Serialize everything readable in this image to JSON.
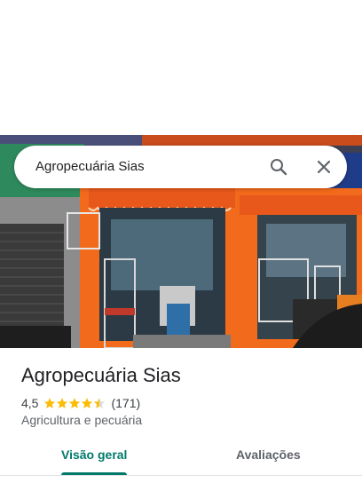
{
  "search": {
    "query": "Agropecuária Sias",
    "search_icon": "search-icon",
    "close_icon": "close-icon"
  },
  "place": {
    "name": "Agropecuária Sias",
    "rating": "4,5",
    "rating_stars": 4.5,
    "review_count": "(171)",
    "category": "Agricultura e pecuária"
  },
  "tabs": [
    {
      "label": "Visão geral",
      "active": true
    },
    {
      "label": "Avaliações",
      "active": false
    }
  ],
  "colors": {
    "accent": "#00796b",
    "star": "#fbbc04",
    "storefront": "#f26a1b"
  }
}
